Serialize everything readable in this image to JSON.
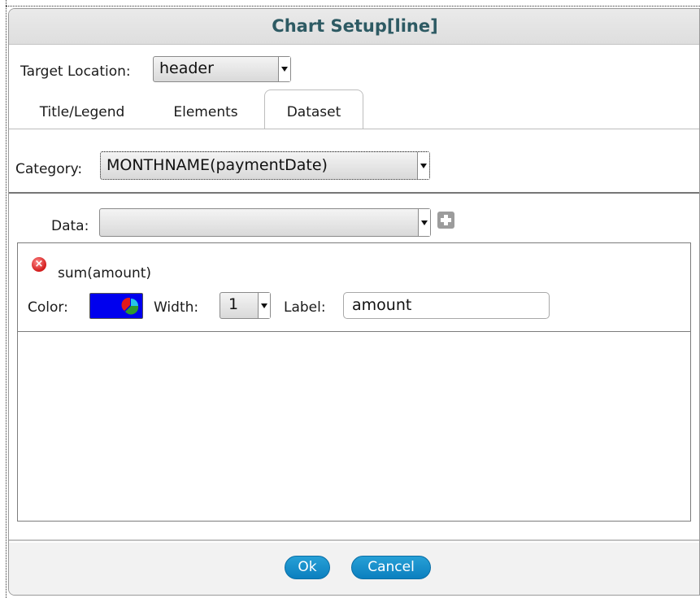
{
  "dialog": {
    "title": "Chart Setup[line]"
  },
  "target_location": {
    "label": "Target Location:",
    "value": "header"
  },
  "tabs": [
    {
      "label": "Title/Legend",
      "active": false
    },
    {
      "label": "Elements",
      "active": false
    },
    {
      "label": "Dataset",
      "active": true
    }
  ],
  "category": {
    "label": "Category:",
    "value": "MONTHNAME(paymentDate)"
  },
  "data": {
    "label": "Data:",
    "value": ""
  },
  "dataset_items": [
    {
      "name": "sum(amount)",
      "color_label": "Color:",
      "color": "#0000ee",
      "width_label": "Width:",
      "width_value": "1",
      "label_label": "Label:",
      "label_value": "amount"
    }
  ],
  "buttons": {
    "ok": "Ok",
    "cancel": "Cancel"
  },
  "colors": {
    "title_text": "#2d5a63",
    "button_blue": "#1590cc",
    "swatch_blue": "#0000ee"
  }
}
